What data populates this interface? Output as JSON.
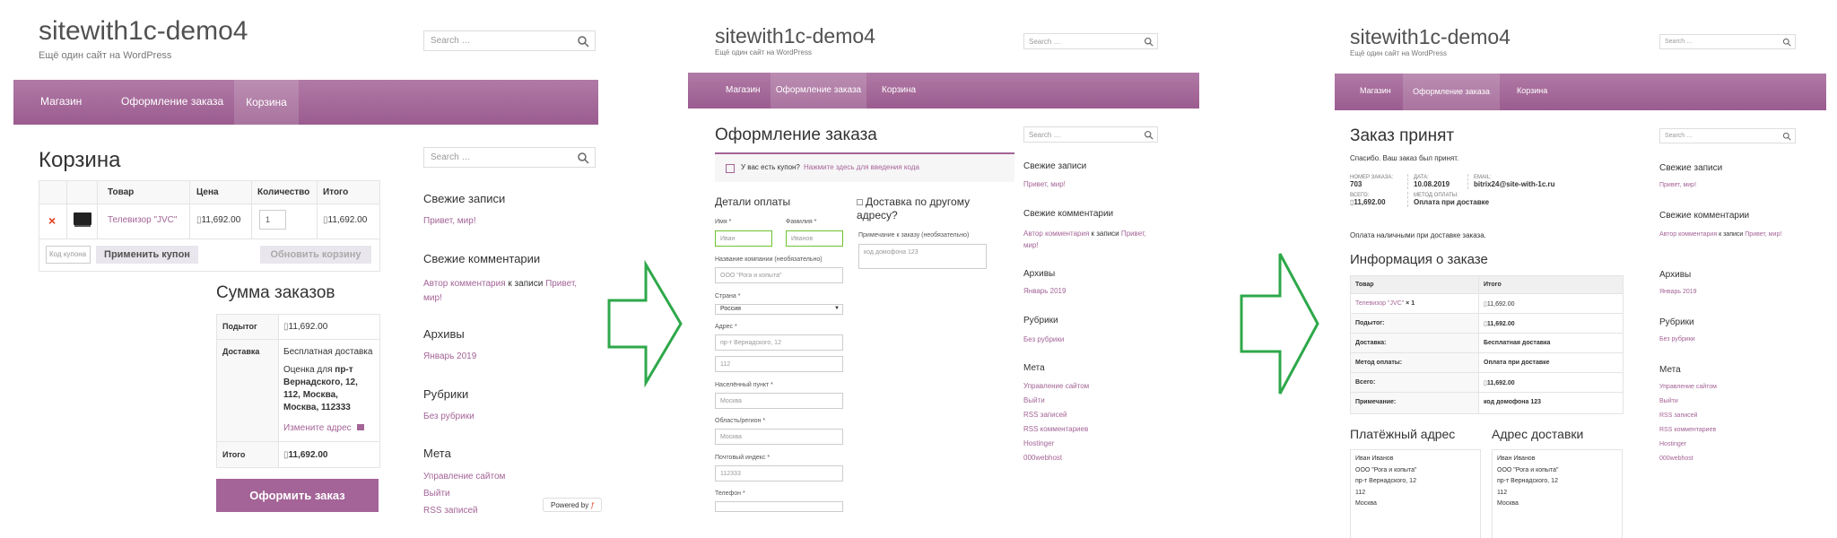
{
  "site": {
    "title": "sitewith1c-demo4",
    "tagline": "Ещё один сайт на WordPress",
    "search_placeholder": "Search …"
  },
  "nav": {
    "shop": "Магазин",
    "checkout": "Оформление заказа",
    "cart": "Корзина"
  },
  "colors": {
    "accent": "#a46497",
    "arrow": "#2ea84a"
  },
  "sidebar": {
    "recent_posts_title": "Свежие записи",
    "recent_post": "Привет, мир!",
    "recent_comments_title": "Свежие комментарии",
    "comment_author": "Автор комментария",
    "comment_on": "к записи",
    "comment_post": "Привет, мир!",
    "archives_title": "Архивы",
    "archive_item": "Январь 2019",
    "categories_title": "Рубрики",
    "category_item": "Без рубрики",
    "meta_title": "Мета",
    "meta_items": [
      "Управление сайтом",
      "Выйти",
      "RSS записей",
      "RSS комментариев",
      "Hostinger",
      "000webhost"
    ]
  },
  "cart": {
    "heading": "Корзина",
    "col_product": "Товар",
    "col_price": "Цена",
    "col_qty": "Количество",
    "col_total": "Итого",
    "item_name": "Телевизор \"JVC\"",
    "item_price": "11,692.00",
    "item_qty": "1",
    "item_total": "11,692.00",
    "remove_icon": "×",
    "coupon_placeholder": "Код купона",
    "apply_coupon": "Применить купон",
    "update_cart": "Обновить корзину",
    "totals_heading": "Сумма заказов",
    "subtotal_label": "Подытог",
    "subtotal_value": "11,692.00",
    "shipping_label": "Доставка",
    "shipping_value": "Бесплатная доставка",
    "estimate_prefix": "Оценка для",
    "estimate_address_1": "пр-т",
    "estimate_address_2": "Вернадского, 12,",
    "estimate_address_3": "112, Москва,",
    "estimate_address_4": "Москва, 112333",
    "change_address": "Измените адрес",
    "total_label": "Итого",
    "total_value": "11,692.00",
    "checkout_button": "Оформить заказ",
    "powered_by": "Powered by"
  },
  "checkout": {
    "heading": "Оформление заказа",
    "coupon_notice_text": "У вас есть купон?",
    "coupon_notice_link": "Нажмите здесь для введения кода",
    "billing_title": "Детали оплаты",
    "first_name_label": "Имя *",
    "first_name_value": "Иван",
    "last_name_label": "Фамилия *",
    "last_name_value": "Иванов",
    "company_label": "Название компании (необязательно)",
    "company_value": "ООО \"Рога и копыта\"",
    "country_label": "Страна *",
    "country_value": "Россия",
    "address_label": "Адрес *",
    "address_value_1": "пр-т Вернадского, 12",
    "address_value_2": "112",
    "city_label": "Населённый пункт *",
    "city_value": "Москва",
    "region_label": "Область/регион *",
    "region_value": "Москва",
    "postcode_label": "Почтовый индекс *",
    "postcode_value": "112333",
    "phone_label": "Телефон *",
    "ship_other_line1": "Доставка по другому",
    "ship_other_line2": "адресу?",
    "order_notes_label": "Примечание к заказу (необязательно)",
    "order_notes_value": "код домофона 123"
  },
  "received": {
    "heading": "Заказ принят",
    "thanks": "Спасибо. Ваш заказ был принят.",
    "order_no_label": "НОМЕР ЗАКАЗА:",
    "order_no": "703",
    "date_label": "ДАТА:",
    "date": "10.08.2019",
    "email_label": "EMAIL:",
    "email": "bitrix24@site-with-1c.ru",
    "total_label": "ВСЕГО:",
    "total": "11,692.00",
    "method_label": "МЕТОД ОПЛАТЫ:",
    "method": "Оплата при доставке",
    "cod_note": "Оплата наличными при доставке заказа.",
    "details_heading": "Информация о заказе",
    "th_product": "Товар",
    "th_total": "Итого",
    "rows": [
      {
        "label": "Телевизор \"JVC\"",
        "qty": "× 1",
        "value": "11,692.00"
      },
      {
        "label": "Подытог:",
        "value": "11,692.00"
      },
      {
        "label": "Доставка:",
        "value": "Бесплатная доставка"
      },
      {
        "label": "Метод оплаты:",
        "value": "Оплата при доставке"
      },
      {
        "label": "Всего:",
        "value": "11,692.00"
      },
      {
        "label": "Примечание:",
        "value": "код домофона 123"
      }
    ],
    "billing_heading": "Платёжный адрес",
    "shipping_heading": "Адрес доставки",
    "address_lines": [
      "Иван Иванов",
      "ООО \"Рога и копыта\"",
      "пр-т Вернадского, 12",
      "112",
      "Москва"
    ]
  }
}
